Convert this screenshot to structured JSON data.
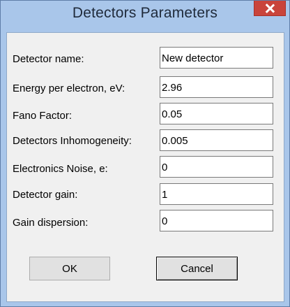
{
  "window": {
    "title": "Detectors Parameters"
  },
  "fields": [
    {
      "label": "Detector name:",
      "value": "New detector"
    },
    {
      "label": "Energy per electron, eV:",
      "value": "2.96"
    },
    {
      "label": "Fano Factor:",
      "value": "0.05"
    },
    {
      "label": "Detectors Inhomogeneity:",
      "value": "0.005"
    },
    {
      "label": "Electronics Noise, e:",
      "value": "0"
    },
    {
      "label": "Detector gain:",
      "value": "1"
    },
    {
      "label": "Gain dispersion:",
      "value": "0"
    }
  ],
  "buttons": {
    "ok_label": "OK",
    "cancel_label": "Cancel"
  },
  "colors": {
    "frame": "#a9c6ea",
    "close_button": "#c9443b",
    "client_background": "#f0f0f0"
  },
  "icons": {
    "close": "close-icon"
  }
}
